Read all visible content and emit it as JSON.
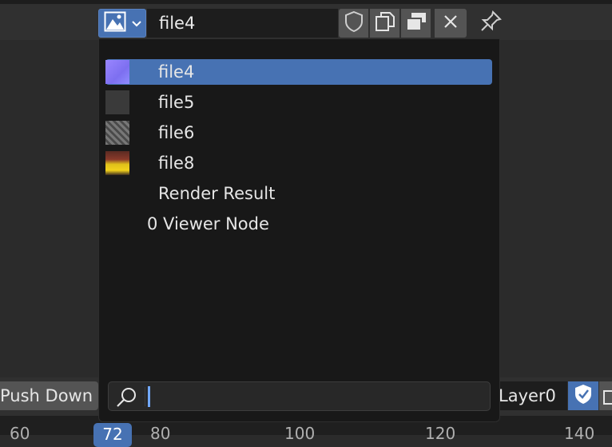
{
  "header": {
    "image_name": "file4"
  },
  "dropdown": {
    "items": [
      {
        "label": "file4",
        "selected": true,
        "thumb": "purple-gradient"
      },
      {
        "label": "file5",
        "selected": false,
        "thumb": "dark-gray"
      },
      {
        "label": "file6",
        "selected": false,
        "thumb": "gray-noise"
      },
      {
        "label": "file8",
        "selected": false,
        "thumb": "yellow-photo"
      },
      {
        "label": "Render Result",
        "selected": false,
        "thumb": "none"
      },
      {
        "label": "0 Viewer Node",
        "selected": false,
        "thumb": "none"
      }
    ],
    "search": {
      "value": "",
      "placeholder": ""
    }
  },
  "bottom": {
    "push_down_label": "Push Down",
    "layer_label": "Layer0"
  },
  "timeline": {
    "current_frame": "72",
    "ticks": [
      "60",
      "80",
      "100",
      "120",
      "140"
    ]
  },
  "colors": {
    "accent": "#4772b3",
    "menu_bg": "#181818",
    "header_bg": "#303030"
  }
}
